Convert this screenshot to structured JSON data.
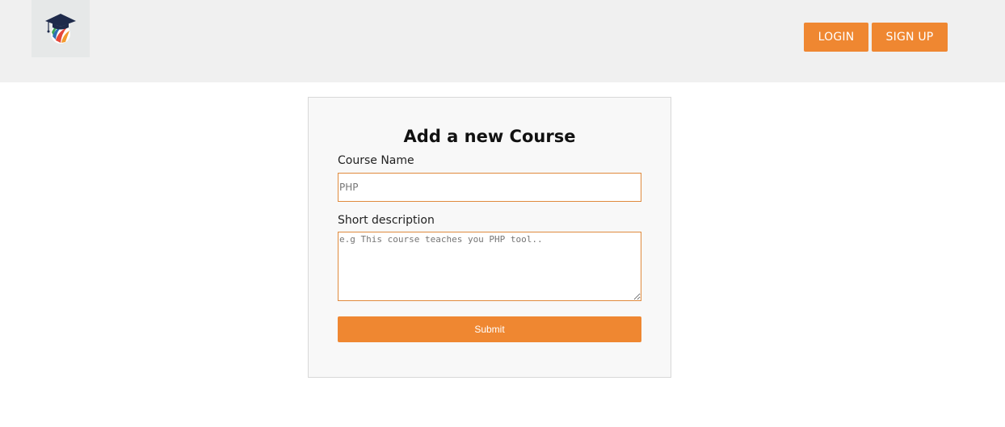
{
  "header": {
    "logo_icon": "graduation-globe-logo",
    "login_label": "LOGIN",
    "signup_label": "SIGN UP"
  },
  "form": {
    "title": "Add a new Course",
    "course_name": {
      "label": "Course Name",
      "placeholder": "PHP",
      "value": ""
    },
    "description": {
      "label": "Short description",
      "placeholder": "e.g This course teaches you PHP tool..",
      "value": ""
    },
    "submit_label": "Submit"
  },
  "colors": {
    "accent": "#ef8731",
    "header_bg": "#f0f0f0",
    "card_bg": "#f8f8f8",
    "logo_cap": "#1e2a4a",
    "logo_green": "#3aa655",
    "logo_blue": "#2f6fb5",
    "logo_red": "#e5473a",
    "logo_orange": "#f29a2e"
  }
}
